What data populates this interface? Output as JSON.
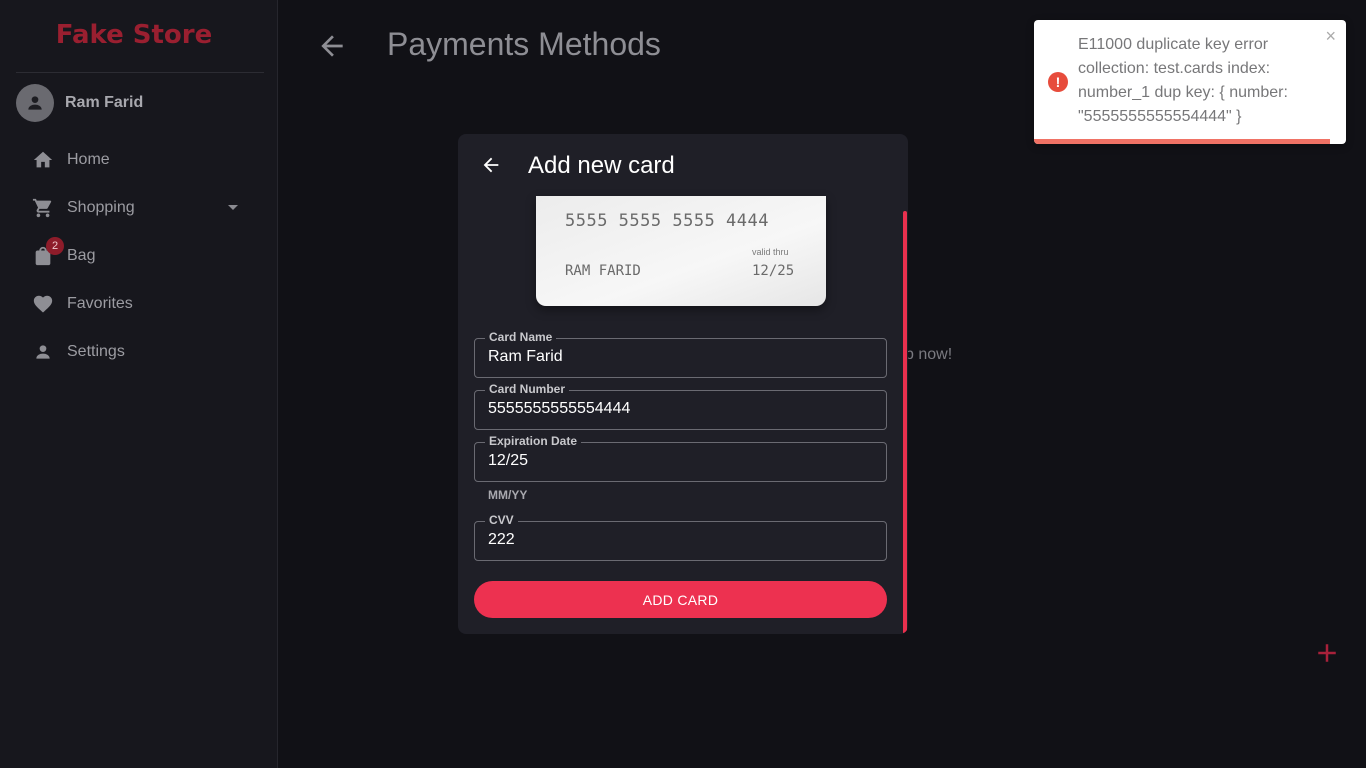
{
  "app": {
    "brand": "Fake Store"
  },
  "user": {
    "name": "Ram Farid"
  },
  "nav": {
    "items": [
      {
        "label": "Home",
        "icon": "home-icon"
      },
      {
        "label": "Shopping",
        "icon": "cart-icon",
        "has_dropdown": true
      },
      {
        "label": "Bag",
        "icon": "bag-icon",
        "badge": "2"
      },
      {
        "label": "Favorites",
        "icon": "heart-icon"
      },
      {
        "label": "Settings",
        "icon": "person-icon"
      }
    ]
  },
  "page": {
    "title": "Payments Methods",
    "background_text": "p now!"
  },
  "dialog": {
    "title": "Add new card",
    "card_preview": {
      "number": "5555 5555 5555 4444",
      "holder": "RAM FARID",
      "valid_label": "valid thru",
      "valid": "12/25"
    },
    "fields": {
      "card_name": {
        "label": "Card Name",
        "value": "Ram Farid"
      },
      "card_number": {
        "label": "Card Number",
        "value": "5555555555554444"
      },
      "expiration": {
        "label": "Expiration Date",
        "value": "12/25",
        "helper": "MM/YY"
      },
      "cvv": {
        "label": "CVV",
        "value": "222"
      }
    },
    "submit_label": "ADD CARD"
  },
  "toast": {
    "message": "E11000 duplicate key error collection: test.cards index: number_1 dup key: { number: \"5555555555554444\" }",
    "close": "×",
    "icon": "!",
    "progress": 0.95
  },
  "colors": {
    "accent": "#ed3150",
    "brand": "#9a1f30",
    "error": "#e74c3c"
  }
}
